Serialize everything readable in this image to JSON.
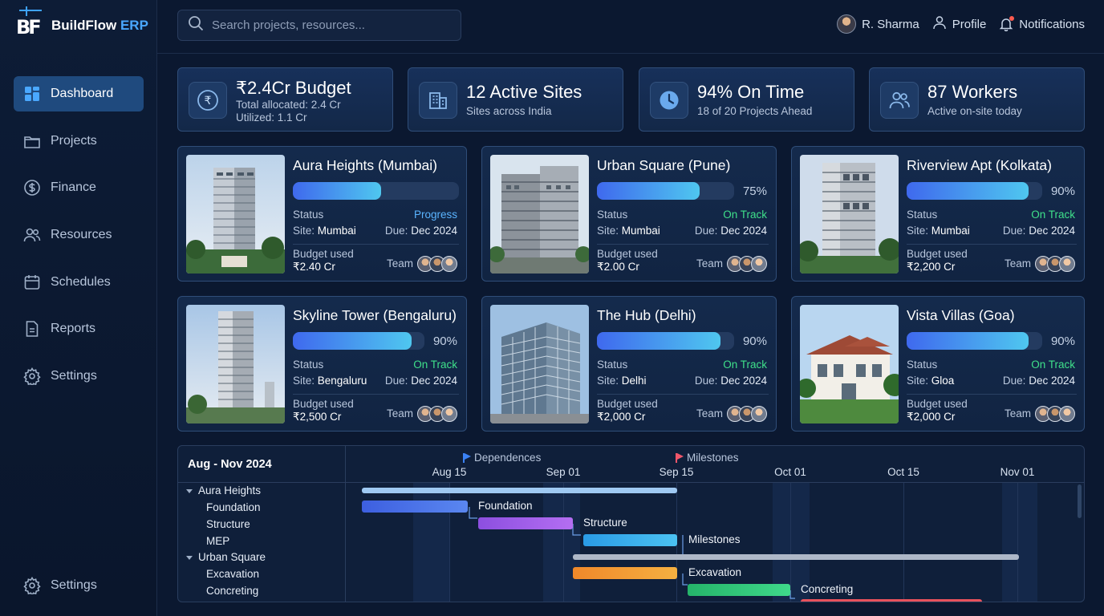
{
  "app": {
    "logo_mark": "BF",
    "name_main": "BuildFlow",
    "name_accent": "ERP"
  },
  "sidebar": {
    "items": [
      {
        "label": "Dashboard",
        "icon": "dashboard-icon",
        "active": true
      },
      {
        "label": "Projects",
        "icon": "folder-icon"
      },
      {
        "label": "Finance",
        "icon": "dollar-icon"
      },
      {
        "label": "Resources",
        "icon": "users-icon"
      },
      {
        "label": "Schedules",
        "icon": "calendar-icon"
      },
      {
        "label": "Reports",
        "icon": "document-icon"
      },
      {
        "label": "Settings",
        "icon": "gear-icon"
      }
    ],
    "bottom": {
      "label": "Settings",
      "icon": "gear-icon"
    }
  },
  "search": {
    "placeholder": "Search projects, resources..."
  },
  "topbar": {
    "user": "R. Sharma",
    "profile": "Profile",
    "notifications": "Notifications"
  },
  "kpis": [
    {
      "title": "₹2.4Cr Budget",
      "sub1": "Total allocated: 2.4 Cr",
      "sub2": "Utilized: 1.1 Cr",
      "icon": "rupee-icon"
    },
    {
      "title": "12 Active Sites",
      "sub1": "Sites across India",
      "icon": "building-icon"
    },
    {
      "title": "94% On Time",
      "sub1": "18 of 20 Projects Ahead",
      "icon": "clock-icon"
    },
    {
      "title": "87 Workers",
      "sub1": "Active on-site today",
      "icon": "users-icon"
    }
  ],
  "projects": [
    {
      "name": "Aura Heights (Mumbai)",
      "progress": 0.53,
      "pct": "",
      "status_label": "Status",
      "status": "Progress",
      "status_color": "#5ab4ff",
      "site_label": "Site:",
      "site": "Mumbai",
      "due_label": "Due:",
      "due": "Dec 2024",
      "budget_label": "Budget used",
      "budget": "₹2.40 Cr",
      "team_label": "Team"
    },
    {
      "name": "Urban Square (Pune)",
      "progress": 0.75,
      "pct": "75%",
      "status_label": "Status",
      "status": "On Track",
      "status_color": "#3fe08a",
      "site_label": "Site:",
      "site": "Mumbai",
      "due_label": "Due:",
      "due": "Dec 2024",
      "budget_label": "Budget used",
      "budget": "₹2.00 Cr",
      "team_label": "Team"
    },
    {
      "name": "Riverview Apt (Kolkata)",
      "progress": 0.9,
      "pct": "90%",
      "status_label": "Status",
      "status": "On Track",
      "status_color": "#3fe08a",
      "site_label": "Site:",
      "site": "Mumbai",
      "due_label": "Due:",
      "due": "Dec 2024",
      "budget_label": "Budget used",
      "budget": "₹2,200 Cr",
      "team_label": "Team"
    },
    {
      "name": "Skyline Tower (Bengaluru)",
      "progress": 0.9,
      "pct": "90%",
      "status_label": "Status",
      "status": "On Track",
      "status_color": "#3fe08a",
      "site_label": "Site:",
      "site": "Bengaluru",
      "due_label": "Due:",
      "due": "Dec 2024",
      "budget_label": "Budget used",
      "budget": "₹2,500 Cr",
      "team_label": "Team"
    },
    {
      "name": "The Hub (Delhi)",
      "progress": 0.9,
      "pct": "90%",
      "status_label": "Status",
      "status": "On Track",
      "status_color": "#3fe08a",
      "site_label": "Site:",
      "site": "Delhi",
      "due_label": "Due:",
      "due": "Dec 2024",
      "budget_label": "Budget used",
      "budget": "₹2,000 Cr",
      "team_label": "Team"
    },
    {
      "name": "Vista Villas (Goa)",
      "progress": 0.9,
      "pct": "90%",
      "status_label": "Status",
      "status": "On Track",
      "status_color": "#3fe08a",
      "site_label": "Site:",
      "site": "Gloa",
      "due_label": "Due:",
      "due": "Dec 2024",
      "budget_label": "Budget used",
      "budget": "₹2,000 Cr",
      "team_label": "Team"
    }
  ],
  "gantt": {
    "range": "Aug - Nov 2024",
    "legend": [
      {
        "label": "Dependences",
        "color": "#3b82f6"
      },
      {
        "label": "Milestones",
        "color": "#f0566a"
      }
    ],
    "dates": [
      "Aug 15",
      "Sep 01",
      "Sep 15",
      "Oct 01",
      "Oct 15",
      "Nov 01"
    ],
    "rows": [
      {
        "label": "Aura Heights",
        "group": true
      },
      {
        "label": "Foundation"
      },
      {
        "label": "Structure"
      },
      {
        "label": "MEP"
      },
      {
        "label": "Urban Square",
        "group": true
      },
      {
        "label": "Excavation"
      },
      {
        "label": "Concreting"
      }
    ],
    "bar_labels": [
      "Foundation",
      "Structure",
      "Milestones",
      "Excavation",
      "Concreting"
    ]
  }
}
